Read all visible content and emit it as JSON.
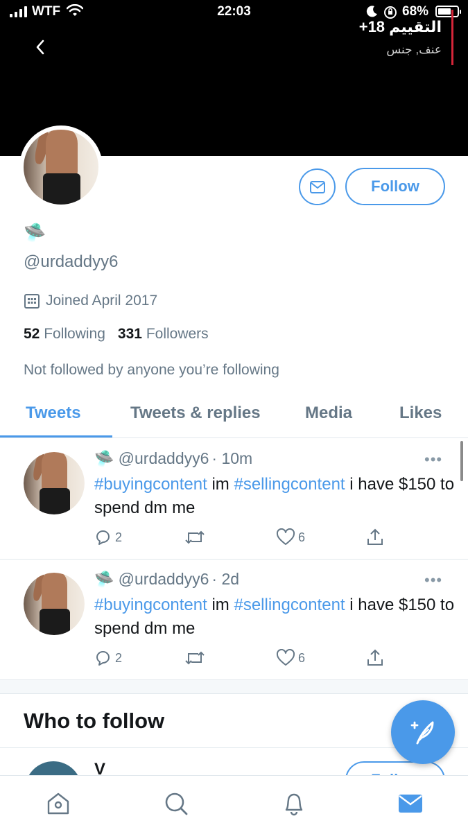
{
  "status_bar": {
    "carrier": "WTF",
    "time": "22:03",
    "battery_percent": "68%",
    "battery_level": 0.68
  },
  "header": {
    "rating_title": "التقييم 18+",
    "rating_tags": "عنف, جنس",
    "back_icon": "chevron-left-icon"
  },
  "profile": {
    "display_name_emoji": "🛸",
    "handle": "@urdaddyy6",
    "joined": "Joined April 2017",
    "following_count": "52",
    "following_label": "Following",
    "followers_count": "331",
    "followers_label": "Followers",
    "not_followed_text": "Not followed by anyone you’re following",
    "follow_button": "Follow",
    "message_icon": "mail-icon"
  },
  "tabs": [
    {
      "label": "Tweets",
      "active": true
    },
    {
      "label": "Tweets & replies",
      "active": false
    },
    {
      "label": "Media",
      "active": false
    },
    {
      "label": "Likes",
      "active": false
    }
  ],
  "tweets": [
    {
      "emoji": "🛸",
      "handle": "@urdaddyy6",
      "time": "· 10m",
      "hashtag1": "#buyingcontent",
      "mid": " im ",
      "hashtag2": "#sellingcontent",
      "rest": " i have $150 to spend dm me",
      "replies": "2",
      "likes": "6",
      "more": "•••"
    },
    {
      "emoji": "🛸",
      "handle": "@urdaddyy6",
      "time": "· 2d",
      "hashtag1": "#buyingcontent",
      "mid": " im ",
      "hashtag2": "#sellingcontent",
      "rest": " i have $150 to spend dm me",
      "replies": "2",
      "likes": "6",
      "more": "•••"
    }
  ],
  "who_to_follow": {
    "title": "Who to follow",
    "first_name": "V",
    "follow_label": "Follow"
  },
  "colors": {
    "accent": "#4a99e9",
    "muted": "#657786",
    "header_bg": "#000000"
  },
  "bottom_nav": [
    "home-icon",
    "search-icon",
    "notifications-icon",
    "messages-icon"
  ]
}
